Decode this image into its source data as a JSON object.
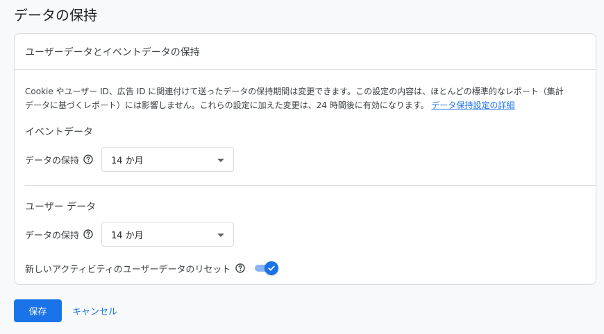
{
  "page": {
    "title": "データの保持"
  },
  "card": {
    "header": "ユーザーデータとイベントデータの保持",
    "description": {
      "line1": "Cookie やユーザー ID、広告 ID に関連付けて送ったデータの保持期間は変更できます。この設定の内容は、ほとんどの標準的なレポート（集計",
      "line2": "データに基づくレポート）には影響しません。これらの設定に加えた変更は、24 時間後に有効になります。",
      "link": "データ保持設定の詳細"
    },
    "event_section": {
      "title": "イベントデータ",
      "retention_label": "データの保持",
      "retention_value": "14 か月"
    },
    "user_section": {
      "title": "ユーザー データ",
      "retention_label": "データの保持",
      "retention_value": "14 か月",
      "reset_label": "新しいアクティビティのユーザーデータのリセット",
      "reset_enabled": true
    }
  },
  "actions": {
    "save_label": "保存",
    "cancel_label": "キャンセル"
  },
  "colors": {
    "accent": "#1a73e8",
    "toggle_track": "#8ab4f8",
    "border": "#dadce0",
    "background": "#f8f9fa"
  },
  "icons": {
    "help": "help-circle-icon",
    "dropdown": "chevron-down-icon",
    "toggle_check": "check-icon"
  }
}
